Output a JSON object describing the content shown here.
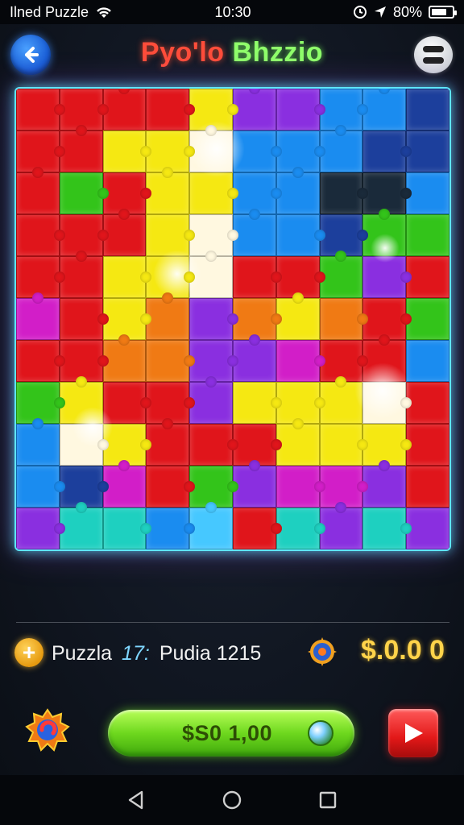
{
  "status_bar": {
    "app_name": "Ilned Puzzle",
    "time": "10:30",
    "battery": "80%",
    "battery_level": 0.8,
    "icons": [
      "wifi-icon",
      "alarm-icon",
      "location-icon",
      "battery-icon"
    ]
  },
  "header": {
    "title_part1": "Pyo'lo",
    "title_part2": "Bhzzio",
    "back_icon": "arrow-left-icon",
    "menu_icon": "menu-icon"
  },
  "board": {
    "columns": 10,
    "rows": 11,
    "palette": {
      "R": "#e0151b",
      "O": "#f07a14",
      "Y": "#f5e812",
      "W": "#fff8e0",
      "G": "#33c41a",
      "T": "#1ed0c0",
      "B": "#1a8cf0",
      "N": "#1c3f9c",
      "P": "#8a2fe0",
      "M": "#d21ec8",
      "D": "#1a2a3a",
      "C": "#46c8ff"
    },
    "layout": [
      "RRRRYPPBBN",
      "RRYYWBBBNN",
      "RGRYYBBDDB",
      "RRRYWBBNGG",
      "RRYYWRRGPR",
      "MRYOPOYORG",
      "RROOPPMRRB",
      "GYRRPYYYWR",
      "BWYRRRYYYR",
      "BNMRGPMMPR",
      "PTTBCRTPTP"
    ],
    "border_color": "#5fe7ff"
  },
  "info_row": {
    "plus_icon": "plus-icon",
    "label_1": "Puzzla",
    "level": "17:",
    "label_2": "Pudia 1215",
    "compass_icon": "compass-icon",
    "coins": "$.0.0 0"
  },
  "bottom_controls": {
    "settings_icon": "emblem-icon",
    "buy_label": "$S0 1,00",
    "orb_icon": "orb-icon",
    "play_icon": "play-icon"
  },
  "nav_bar": {
    "icons": [
      "back-triangle-icon",
      "home-circle-icon",
      "recents-square-icon"
    ]
  }
}
